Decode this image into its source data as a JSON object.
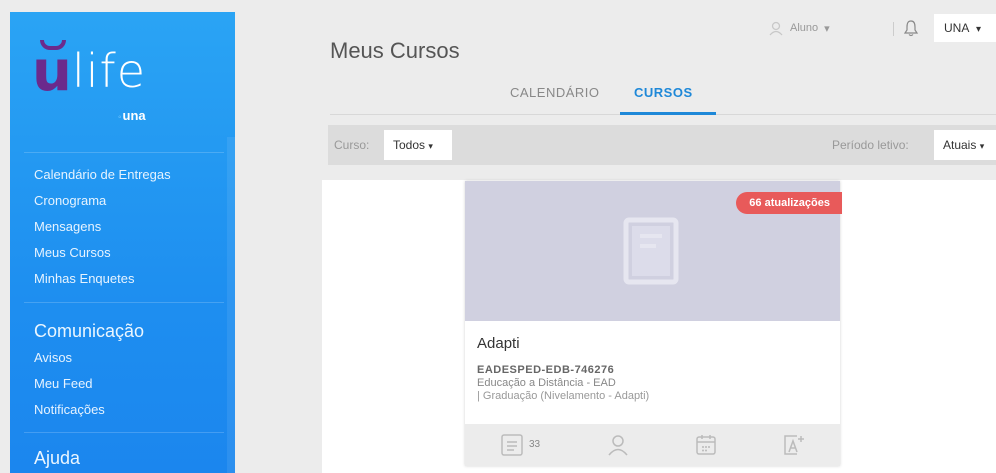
{
  "sidebar": {
    "logo": {
      "brand": "ulife",
      "sub": "una"
    },
    "items": [
      {
        "label": "Calendário de Entregas"
      },
      {
        "label": "Cronograma"
      },
      {
        "label": "Mensagens"
      },
      {
        "label": "Meus Cursos"
      },
      {
        "label": "Minhas Enquetes"
      }
    ],
    "comunicacao": {
      "heading": "Comunicação",
      "items": [
        {
          "label": "Avisos"
        },
        {
          "label": "Meu Feed"
        },
        {
          "label": "Notificações"
        }
      ]
    },
    "ajuda": {
      "heading": "Ajuda"
    }
  },
  "topbar": {
    "user_label": "Aluno",
    "user_caret": "▾",
    "institution": "UNA",
    "institution_caret": "▾"
  },
  "page": {
    "title": "Meus Cursos",
    "tabs": [
      {
        "label": "CALENDÁRIO"
      },
      {
        "label": "CURSOS"
      }
    ]
  },
  "filters": {
    "curso_label": "Curso:",
    "curso_value": "Todos",
    "periodo_label": "Período letivo:",
    "periodo_value": "Atuais",
    "caret": "▾"
  },
  "course_card": {
    "badge": "66 atualizações",
    "title": "Adapti",
    "code": "EADESPED-EDB-746276",
    "line1": "Educação a Distância - EAD",
    "line2": "| Graduação (Nivelamento - Adapti)",
    "posts_count": "33"
  },
  "colors": {
    "sidebar": "#1e8ff0",
    "accent": "#1e88d8",
    "badge": "#e85a5a",
    "logo_u": "#6b2a8c",
    "card_image_bg": "#d0d0e0"
  }
}
